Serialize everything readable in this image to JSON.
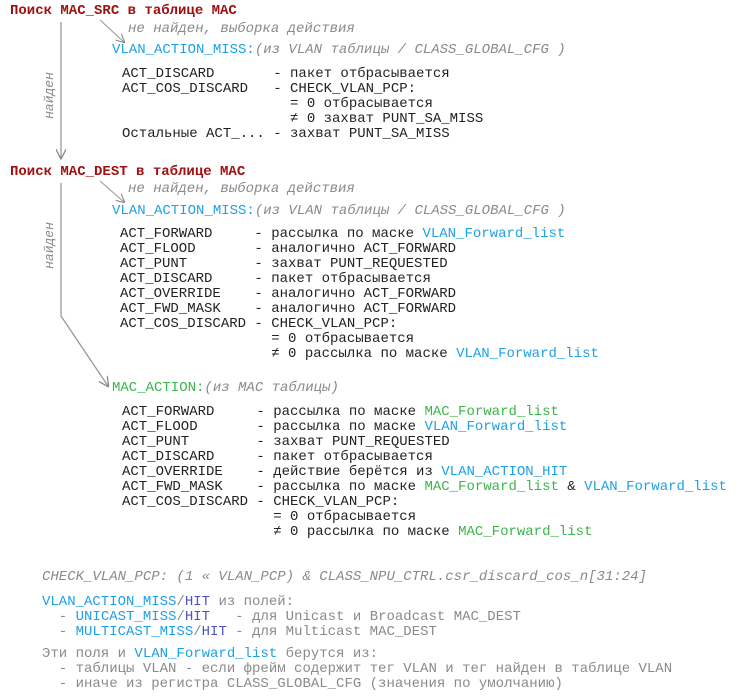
{
  "colors": {
    "title": "#a01010",
    "vlan": "#1ea0e6",
    "mac": "#3cb44b",
    "hit": "#5050c8",
    "note": "#8a8a8a"
  },
  "src": {
    "title": "Поиск MAC_SRC в таблице MAC",
    "found": "найден",
    "miss_note": "не найден, выборка действия",
    "header": [
      {
        "t": "VLAN_ACTION_MISS:",
        "c": "cyan"
      },
      {
        "t": "(из VLAN таблицы / CLASS_GLOBAL_CFG )",
        "c": "it"
      }
    ],
    "rows": [
      {
        "name": "ACT_DISCARD",
        "desc": [
          {
            "t": "- пакет отбрасывается",
            "c": "k"
          }
        ]
      },
      {
        "name": "ACT_COS_DISCARD",
        "desc": [
          {
            "t": "- CHECK_VLAN_PCP:",
            "c": "k"
          }
        ]
      },
      {
        "name": "",
        "desc": [
          {
            "t": "  = 0 отбрасывается",
            "c": "k"
          }
        ]
      },
      {
        "name": "",
        "desc": [
          {
            "t": "  ≠ 0 захват PUNT_SA_MISS",
            "c": "k"
          }
        ]
      },
      {
        "name": "Остальные ACT_...",
        "desc": [
          {
            "t": "- захват PUNT_SA_MISS",
            "c": "k"
          }
        ]
      }
    ]
  },
  "dest": {
    "title": "Поиск MAC_DEST в таблице MAC",
    "found": "найден",
    "miss_note": "не найден, выборка действия",
    "header": [
      {
        "t": "VLAN_ACTION_MISS:",
        "c": "cyan"
      },
      {
        "t": "(из VLAN таблицы / CLASS_GLOBAL_CFG )",
        "c": "it"
      }
    ],
    "rows": [
      {
        "name": "ACT_FORWARD",
        "desc": [
          {
            "t": "- рассылка по маске ",
            "c": "k"
          },
          {
            "t": "VLAN_Forward_list",
            "c": "cyan"
          }
        ]
      },
      {
        "name": "ACT_FLOOD",
        "desc": [
          {
            "t": "- аналогично ACT_FORWARD",
            "c": "k"
          }
        ]
      },
      {
        "name": "ACT_PUNT",
        "desc": [
          {
            "t": "- захват PUNT_REQUESTED",
            "c": "k"
          }
        ]
      },
      {
        "name": "ACT_DISCARD",
        "desc": [
          {
            "t": "- пакет отбрасывается",
            "c": "k"
          }
        ]
      },
      {
        "name": "ACT_OVERRIDE",
        "desc": [
          {
            "t": "- аналогично ACT_FORWARD",
            "c": "k"
          }
        ]
      },
      {
        "name": "ACT_FWD_MASK",
        "desc": [
          {
            "t": "- аналогично ACT_FORWARD",
            "c": "k"
          }
        ]
      },
      {
        "name": "ACT_COS_DISCARD",
        "desc": [
          {
            "t": "- CHECK_VLAN_PCP:",
            "c": "k"
          }
        ]
      },
      {
        "name": "",
        "desc": [
          {
            "t": "  = 0 отбрасывается",
            "c": "k"
          }
        ]
      },
      {
        "name": "",
        "desc": [
          {
            "t": "  ≠ 0 рассылка по маске ",
            "c": "k"
          },
          {
            "t": "VLAN_Forward_list",
            "c": "cyan"
          }
        ]
      }
    ]
  },
  "mac": {
    "header": [
      {
        "t": "MAC_ACTION:",
        "c": "green"
      },
      {
        "t": "(из MAC таблицы)",
        "c": "it"
      }
    ],
    "rows": [
      {
        "name": "ACT_FORWARD",
        "desc": [
          {
            "t": "- рассылка по маске ",
            "c": "k"
          },
          {
            "t": "MAC_Forward_list",
            "c": "green"
          }
        ]
      },
      {
        "name": "ACT_FLOOD",
        "desc": [
          {
            "t": "- рассылка по маске ",
            "c": "k"
          },
          {
            "t": "VLAN_Forward_list",
            "c": "cyan"
          }
        ]
      },
      {
        "name": "ACT_PUNT",
        "desc": [
          {
            "t": "- захват PUNT_REQUESTED",
            "c": "k"
          }
        ]
      },
      {
        "name": "ACT_DISCARD",
        "desc": [
          {
            "t": "- пакет отбрасывается",
            "c": "k"
          }
        ]
      },
      {
        "name": "ACT_OVERRIDE",
        "desc": [
          {
            "t": "- действие берётся из ",
            "c": "k"
          },
          {
            "t": "VLAN_ACTION_HIT",
            "c": "cyan"
          }
        ]
      },
      {
        "name": "ACT_FWD_MASK",
        "desc": [
          {
            "t": "- рассылка по маске ",
            "c": "k"
          },
          {
            "t": "MAC_Forward_list",
            "c": "green"
          },
          {
            "t": " & ",
            "c": "k"
          },
          {
            "t": "VLAN_Forward_list",
            "c": "cyan"
          }
        ]
      },
      {
        "name": "ACT_COS_DISCARD",
        "desc": [
          {
            "t": "- CHECK_VLAN_PCP:",
            "c": "k"
          }
        ]
      },
      {
        "name": "",
        "desc": [
          {
            "t": "  = 0 отбрасывается",
            "c": "k"
          }
        ]
      },
      {
        "name": "",
        "desc": [
          {
            "t": "  ≠ 0 рассылка по маске ",
            "c": "k"
          },
          {
            "t": "MAC_Forward_list",
            "c": "green"
          }
        ]
      }
    ]
  },
  "notes": {
    "check": [
      [
        {
          "t": "CHECK_VLAN_PCP: (1 « VLAN_PCP) & CLASS_NPU_CTRL.csr_discard_cos_n[31:24]",
          "c": "it"
        }
      ]
    ],
    "fields": [
      [
        {
          "t": "VLAN_ACTION_MISS",
          "c": "cyan"
        },
        {
          "t": "/",
          "c": "gray"
        },
        {
          "t": "HIT",
          "c": "blue"
        },
        {
          "t": " из полей:",
          "c": "gray"
        }
      ],
      [
        {
          "t": "  - ",
          "c": "gray"
        },
        {
          "t": "UNICAST_MISS",
          "c": "cyan"
        },
        {
          "t": "/",
          "c": "gray"
        },
        {
          "t": "HIT",
          "c": "blue"
        },
        {
          "t": "   - для Unicast и Broadcast MAC_DEST",
          "c": "gray"
        }
      ],
      [
        {
          "t": "  - ",
          "c": "gray"
        },
        {
          "t": "MULTICAST_MISS",
          "c": "cyan"
        },
        {
          "t": "/",
          "c": "gray"
        },
        {
          "t": "HIT",
          "c": "blue"
        },
        {
          "t": " - для Multicast MAC_DEST",
          "c": "gray"
        }
      ]
    ],
    "source": [
      [
        {
          "t": "Эти поля и ",
          "c": "gray"
        },
        {
          "t": "VLAN_Forward_list",
          "c": "cyan"
        },
        {
          "t": " берутся из:",
          "c": "gray"
        }
      ],
      [
        {
          "t": "  - таблицы VLAN - если фрейм содержит тег VLAN и тег найден в таблице VLAN",
          "c": "gray"
        }
      ],
      [
        {
          "t": "  - иначе из регистра CLASS_GLOBAL_CFG (значения по умолчанию)",
          "c": "gray"
        }
      ]
    ]
  }
}
